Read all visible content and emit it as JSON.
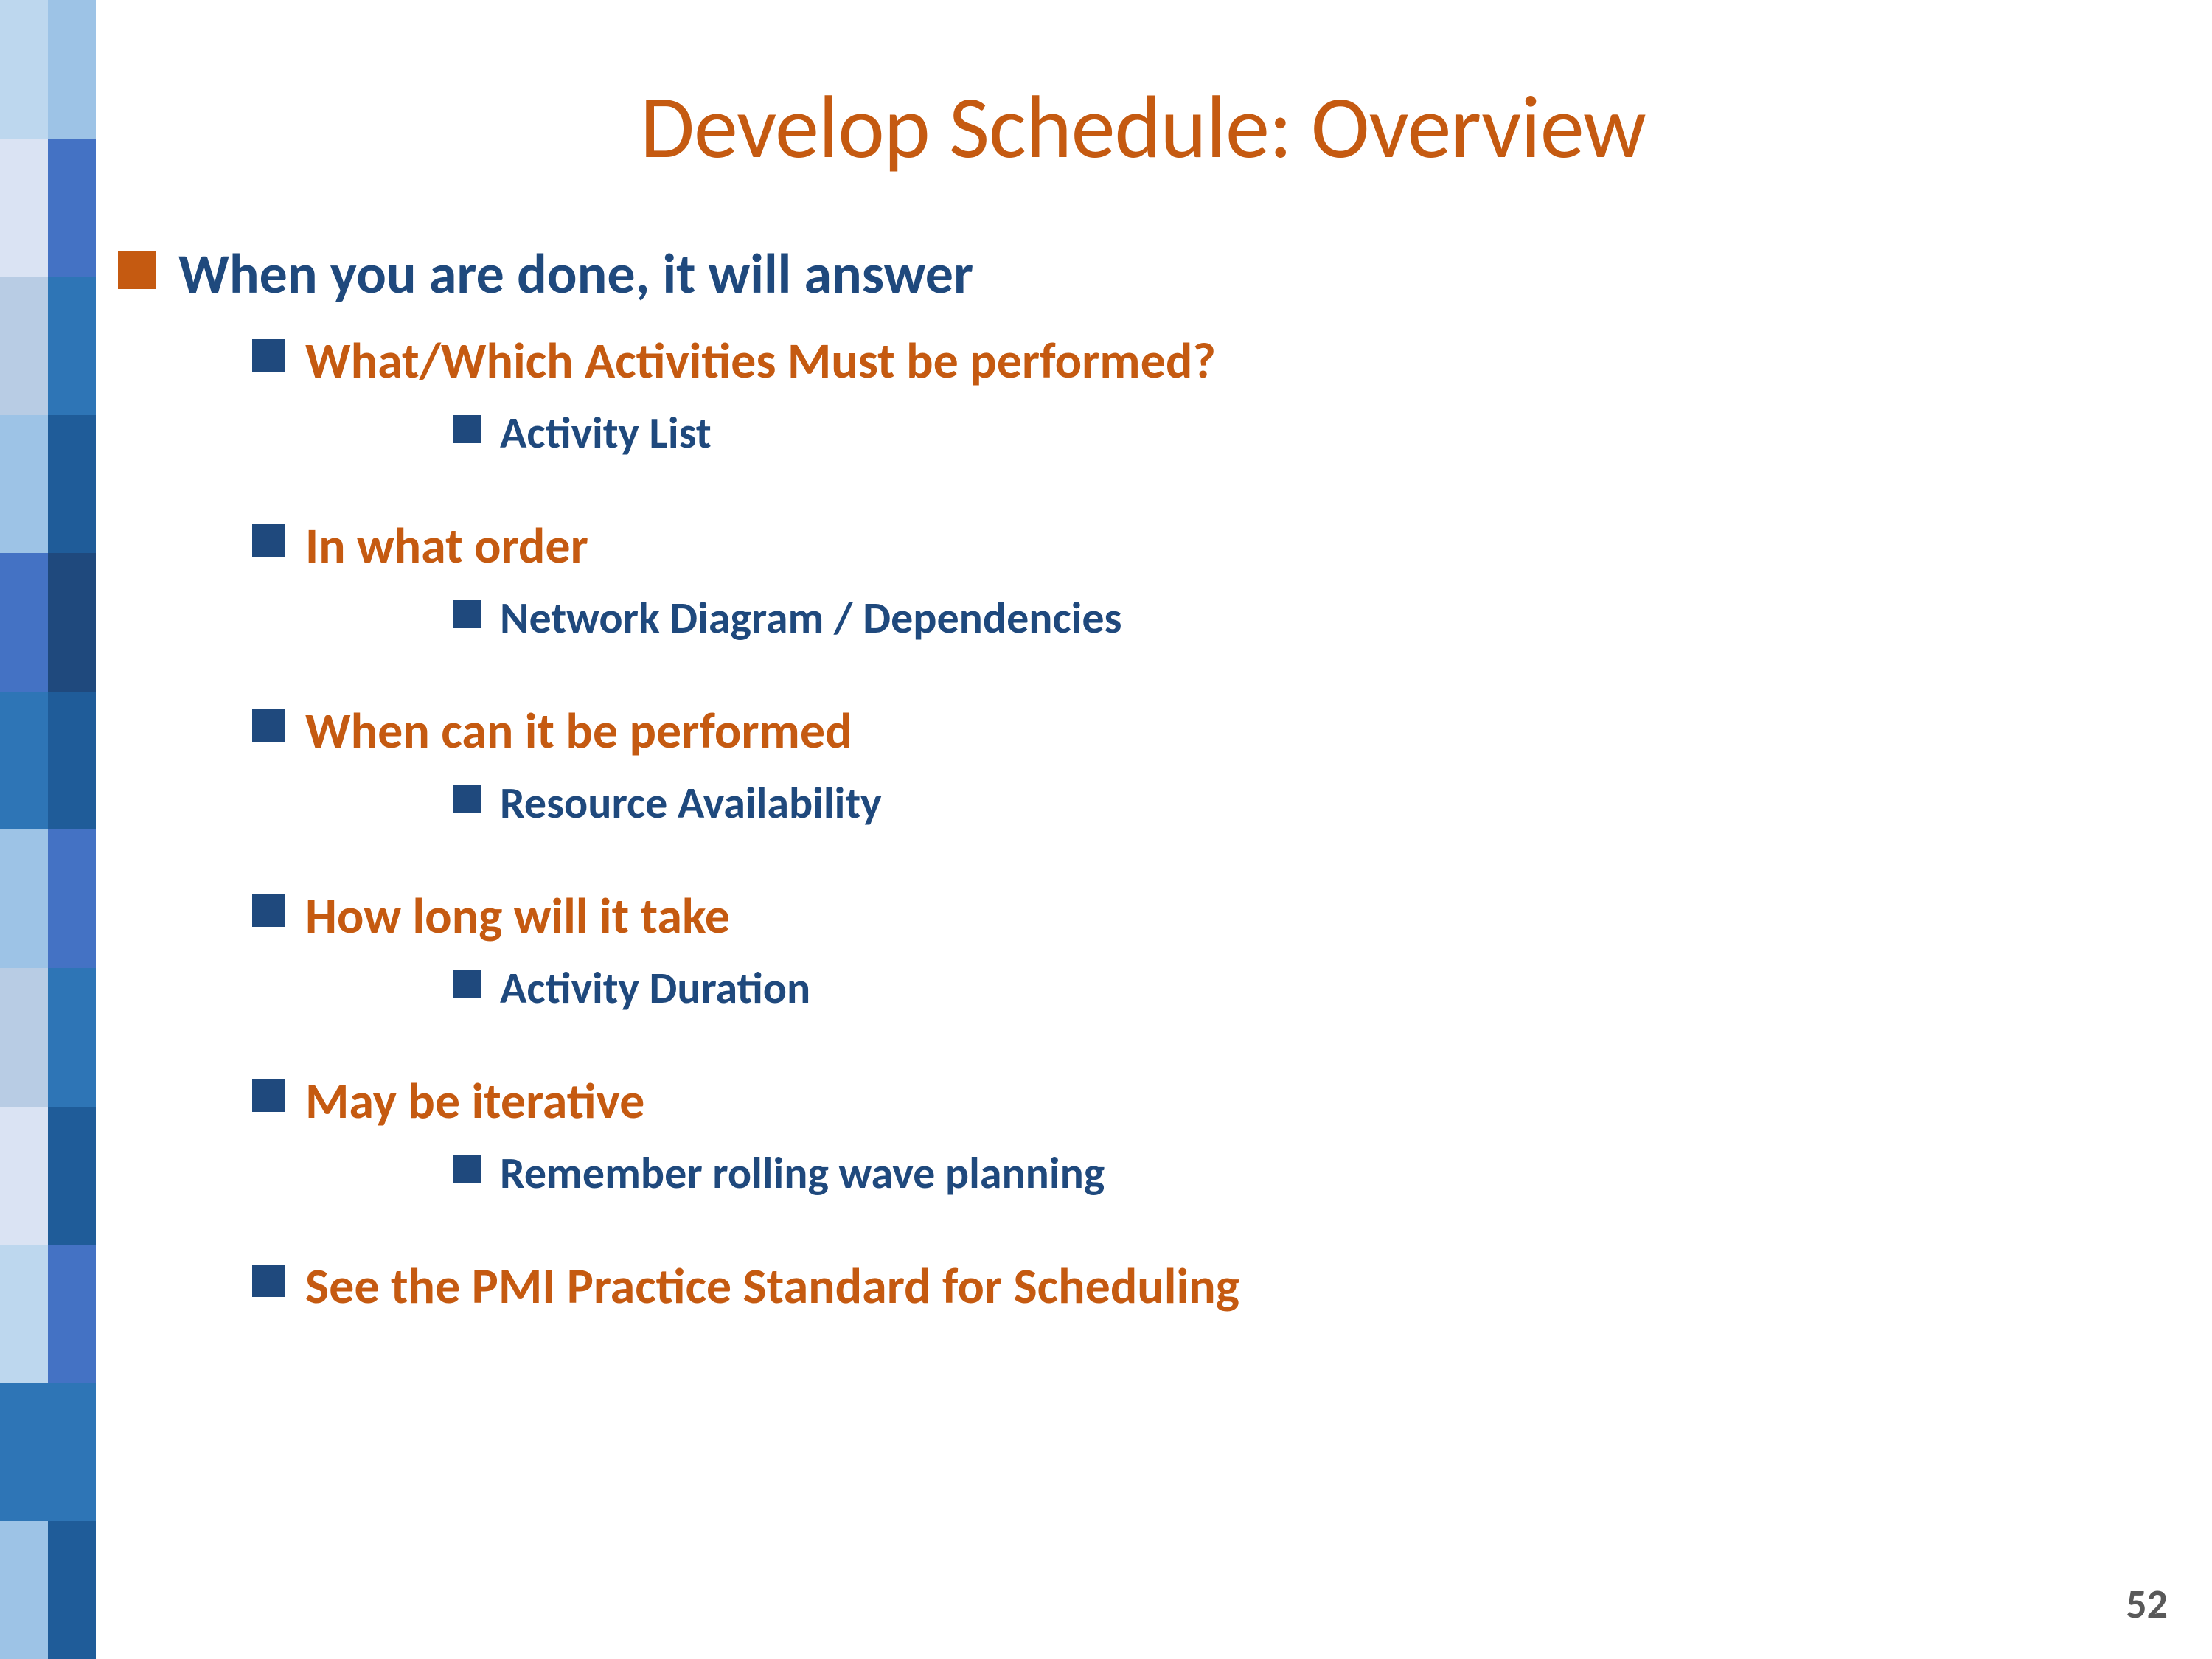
{
  "slide": {
    "title": "Develop Schedule: Overview",
    "page_number": "52",
    "colors": {
      "orange": "#c55a11",
      "dark_blue": "#1f497d",
      "strip_colors": [
        {
          "outer": "#b8cce4",
          "inner": "#4472c4"
        },
        {
          "outer": "#9dc3e6",
          "inner": "#2e75b6"
        },
        {
          "outer": "#bdd7ee",
          "inner": "#1f5c99"
        },
        {
          "outer": "#dae3f3",
          "inner": "#4472c4"
        },
        {
          "outer": "#2e75b6",
          "inner": "#1f5c99"
        },
        {
          "outer": "#9dc3e6",
          "inner": "#4472c4"
        },
        {
          "outer": "#b8cce4",
          "inner": "#2e75b6"
        },
        {
          "outer": "#dae3f3",
          "inner": "#1f5c99"
        },
        {
          "outer": "#bdd7ee",
          "inner": "#4472c4"
        },
        {
          "outer": "#2e75b6",
          "inner": "#2e75b6"
        },
        {
          "outer": "#9dc3e6",
          "inner": "#1f5c99"
        },
        {
          "outer": "#b8cce4",
          "inner": "#4472c4"
        }
      ]
    },
    "items": [
      {
        "level": 1,
        "text": "When you are done, it will answer",
        "children": [
          {
            "level": 2,
            "text": "What/Which Activities Must be performed?",
            "children": [
              {
                "level": 3,
                "text": "Activity List"
              }
            ]
          },
          {
            "level": 2,
            "text": "In what order",
            "children": [
              {
                "level": 3,
                "text": "Network Diagram / Dependencies"
              }
            ]
          },
          {
            "level": 2,
            "text": "When can it be performed",
            "children": [
              {
                "level": 3,
                "text": "Resource Availability"
              }
            ]
          },
          {
            "level": 2,
            "text": "How long will it take",
            "children": [
              {
                "level": 3,
                "text": "Activity Duration"
              }
            ]
          },
          {
            "level": 2,
            "text": "May be iterative",
            "children": [
              {
                "level": 3,
                "text": "Remember rolling wave planning"
              }
            ]
          },
          {
            "level": 2,
            "text": "See the PMI Practice Standard for Scheduling",
            "children": []
          }
        ]
      }
    ]
  }
}
